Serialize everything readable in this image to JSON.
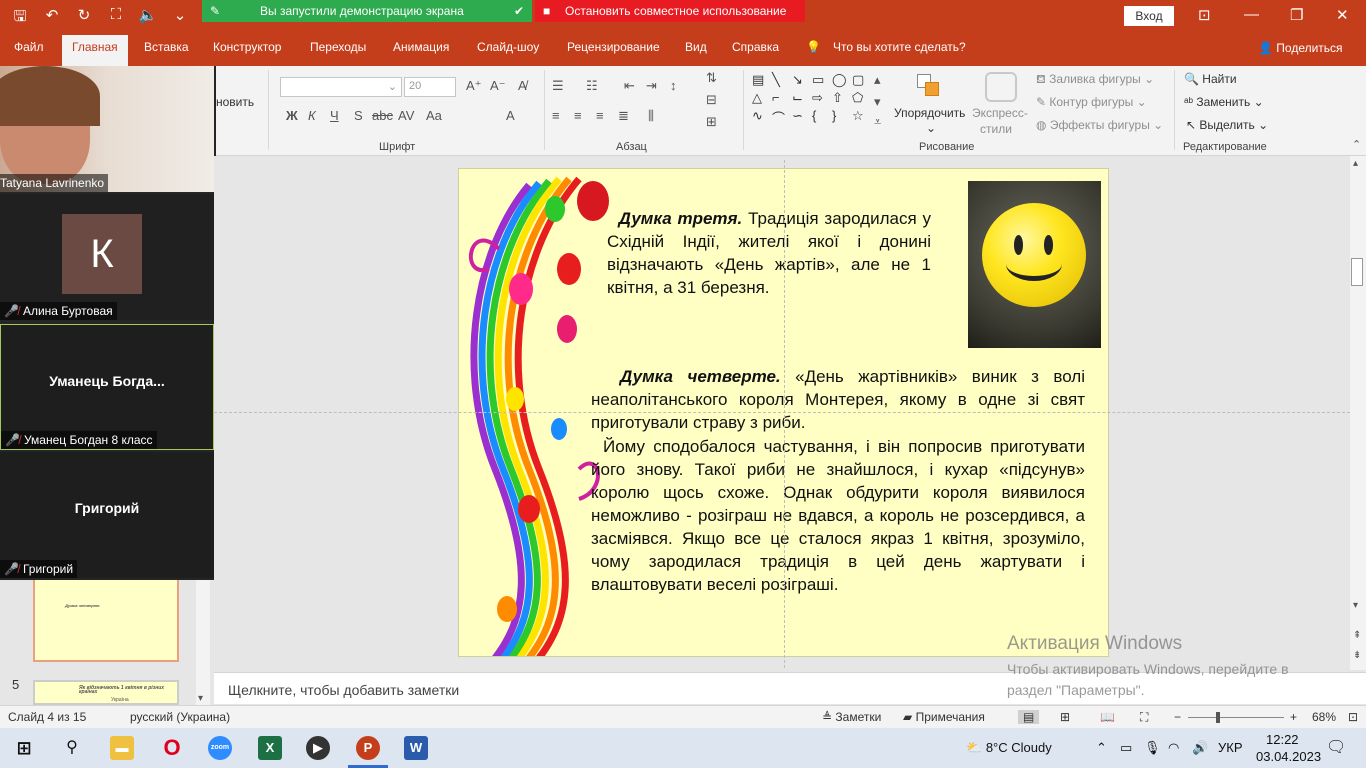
{
  "titlebar": {
    "share_banner": "Вы запустили демонстрацию экрана",
    "stop_banner": "Остановить совместное использование",
    "signin": "Вход"
  },
  "menu": {
    "tabs": [
      "Файл",
      "Главная",
      "Вставка",
      "Конструктор",
      "Переходы",
      "Анимация",
      "Слайд-шоу",
      "Рецензирование",
      "Вид",
      "Справка"
    ],
    "search": "Что вы хотите сделать?",
    "share": "Поделиться"
  },
  "ribbon": {
    "font_size": "20",
    "replace_partial": "новить",
    "font_buttons": [
      "Ж",
      "К",
      "Ч",
      "S",
      "abc",
      "AV",
      "Aa",
      "A"
    ],
    "arrange": "Упорядочить",
    "quick_styles_1": "Экспресс-",
    "quick_styles_2": "стили",
    "shape_fill": "Заливка фигуры",
    "shape_outline": "Контур фигуры",
    "shape_effects": "Эффекты фигуры",
    "find": "Найти",
    "replace": "Заменить",
    "select": "Выделить",
    "groups": {
      "font": "Шрифт",
      "paragraph": "Абзац",
      "drawing": "Рисование",
      "editing": "Редактирование"
    }
  },
  "participants": [
    {
      "name": "Tatyana Lavrinenko",
      "type": "video"
    },
    {
      "name": "Алина Буртовая",
      "type": "avatar",
      "initial": "К"
    },
    {
      "name": "Уманец Богдан 8 класс",
      "type": "name",
      "display": "Уманець  Богда..."
    },
    {
      "name": "Григорий",
      "type": "name",
      "display": "Григорий"
    }
  ],
  "thumbnails": {
    "next_number": "5",
    "thumb4_title": "Думка четверте.",
    "thumb5_title": "Як відзначають 1 квітня в різних країнах",
    "thumb5_sub": "Україна"
  },
  "slide": {
    "p1_title": "Думка третя.",
    "p1_text": "Традиція зародилася у Східній Індії, жителі якої і донині відзначають «День жартів», але не 1 квітня, а 31 березня.",
    "p2_title": "Думка четверте.",
    "p2_text": "«День жартівників» виник з волі неаполітанського короля Монтерея, якому в одне зі свят приготували страву з риби.",
    "p3_text": "Йому сподобалося частування, і він попросив приготувати його знову. Такої риби не знайшлося, і кухар «підсунув» королю щось схоже. Однак обдурити короля виявилося неможливо - розіграш не вдався, а король не розсердився, а засміявся. Якщо все це сталося якраз 1 квітня, зрозуміло, чому зародилася традиція в цей день жартувати і влаштовувати веселі розіграші."
  },
  "notes_placeholder": "Щелкните, чтобы добавить заметки",
  "activation": {
    "title": "Активация Windows",
    "text": "Чтобы активировать Windows, перейдите в раздел \"Параметры\"."
  },
  "status": {
    "slide": "Слайд 4 из 15",
    "language": "русский (Украина)",
    "notes": "Заметки",
    "comments": "Примечания",
    "zoom": "68%"
  },
  "taskbar": {
    "weather": "8°C  Cloudy",
    "lang": "УКР",
    "time": "12:22",
    "date": "03.04.2023",
    "zoom_label": "zoom"
  },
  "colors": {
    "accent": "#c43e1c",
    "banner_green": "#2eaa4f",
    "banner_red": "#e81b23",
    "slide_bg": "#ffffc4"
  }
}
